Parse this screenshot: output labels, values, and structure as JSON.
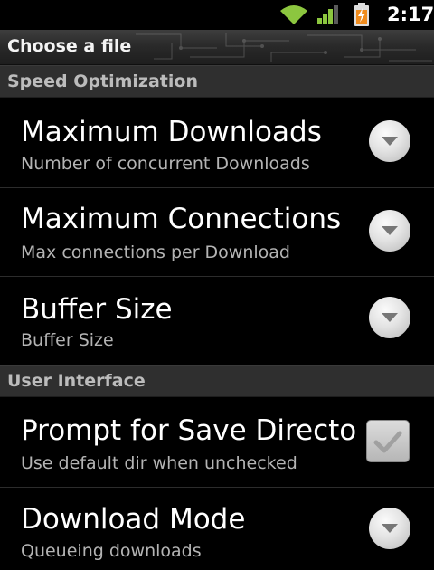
{
  "status_bar": {
    "clock": "2:17",
    "wifi_icon": "wifi-icon",
    "signal_icon": "signal-icon",
    "battery_icon": "battery-charging-icon",
    "colors": {
      "wifi": "#8cc63f",
      "signal": "#8cc63f",
      "battery": "#f08c1e"
    }
  },
  "title_bar": {
    "title": "Choose a file"
  },
  "sections": [
    {
      "label": "Speed Optimization",
      "items": [
        {
          "title": "Maximum Downloads",
          "summary": "Number of concurrent Downloads",
          "widget": "dropdown"
        },
        {
          "title": "Maximum Connections",
          "summary": "Max connections per Download",
          "widget": "dropdown"
        },
        {
          "title": "Buffer Size",
          "summary": "Buffer Size",
          "widget": "dropdown"
        }
      ]
    },
    {
      "label": "User Interface",
      "items": [
        {
          "title": "Prompt for Save Director",
          "summary": "Use default dir when unchecked",
          "widget": "checkbox",
          "checked": false
        },
        {
          "title": "Download Mode",
          "summary": "Queueing downloads",
          "widget": "dropdown"
        }
      ]
    }
  ]
}
